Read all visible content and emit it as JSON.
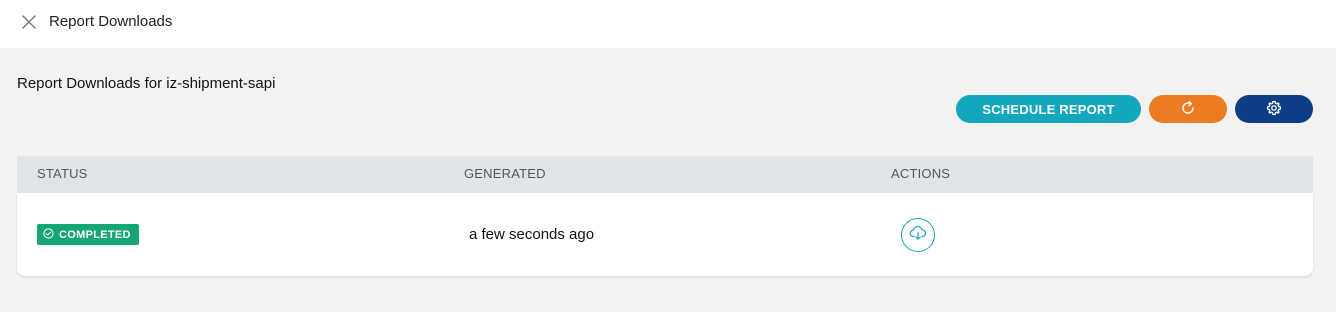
{
  "topbar": {
    "title": "Report Downloads",
    "close_icon": "close-icon"
  },
  "page": {
    "title": "Report Downloads for iz-shipment-sapi"
  },
  "toolbar": {
    "schedule_label": "SCHEDULE REPORT",
    "refresh_icon": "refresh-icon",
    "settings_icon": "gear-icon",
    "colors": {
      "schedule": "#13a7bd",
      "refresh": "#ec7b23",
      "settings": "#0d3e85"
    }
  },
  "table": {
    "columns": [
      "STATUS",
      "GENERATED",
      "ACTIONS"
    ],
    "rows": [
      {
        "status": "COMPLETED",
        "status_icon": "check-circle-icon",
        "status_color": "#16a574",
        "generated": "a few seconds ago",
        "action_icon": "cloud-download-icon"
      }
    ]
  }
}
